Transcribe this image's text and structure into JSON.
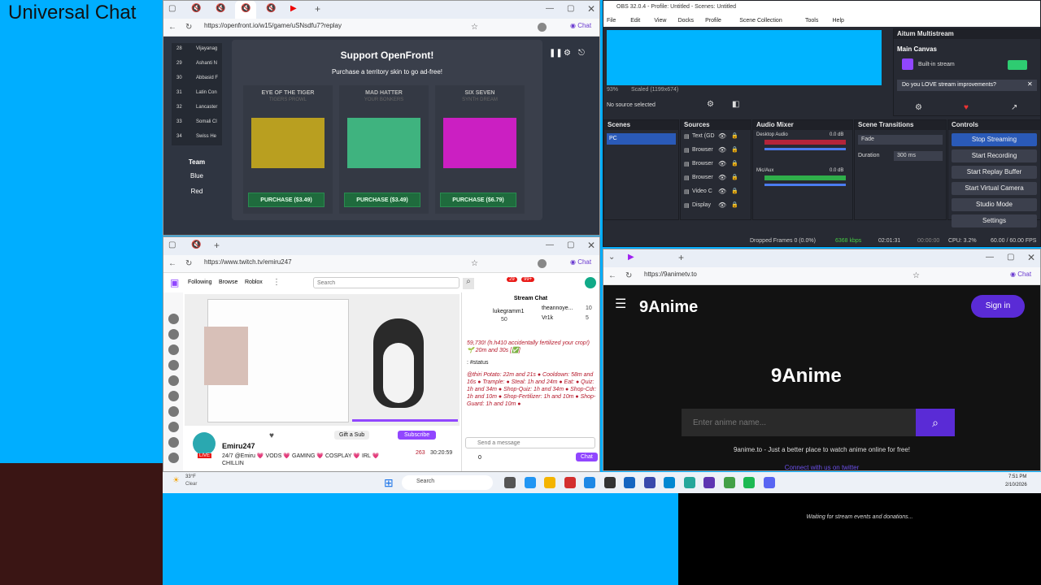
{
  "overlay": {
    "title": "Universal Chat",
    "waiting_text": "Waiting for stream events and donations..."
  },
  "openfront": {
    "url": "https://openfront.io/w15/game/uSNsdfu7?replay",
    "rank_rows": [
      {
        "rank": "28",
        "name": "Vijayanag"
      },
      {
        "rank": "29",
        "name": "Ashanti N"
      },
      {
        "rank": "30",
        "name": "Abbasid F"
      },
      {
        "rank": "31",
        "name": "Latin Con"
      },
      {
        "rank": "32",
        "name": "Lancaster"
      },
      {
        "rank": "33",
        "name": "Somali Cl"
      },
      {
        "rank": "34",
        "name": "Swiss He"
      }
    ],
    "team_header": "Team",
    "teams": [
      "Blue",
      "Red"
    ],
    "modal_title": "Support OpenFront!",
    "modal_subtitle": "Purchase a territory skin to go ad-free!",
    "skins": [
      {
        "name": "EYE OF THE TIGER",
        "sub": "TIGERS PROWL",
        "button": "PURCHASE  ($3.49)",
        "color": "#d1b21a"
      },
      {
        "name": "MAD HATTER",
        "sub": "YOUR BONKERS",
        "button": "PURCHASE  ($3.49)",
        "color": "#42c98a"
      },
      {
        "name": "SIX SEVEN",
        "sub": "SYNTH DREAM",
        "button": "PURCHASE  ($6.79)",
        "color": "#e61bd8"
      }
    ]
  },
  "obs": {
    "title": "OBS 32.0.4 - Profile: Untitled - Scenes: Untitled",
    "menu": [
      "File",
      "Edit",
      "View",
      "Docks",
      "Profile",
      "Scene Collection",
      "Tools",
      "Help"
    ],
    "zoom": "93%",
    "scaled": "Scaled (1199x674)",
    "no_source": "No source selected",
    "aitum_title": "Aitum Multistream",
    "main_canvas": "Main Canvas",
    "builtin_stream": "Built-in stream",
    "love_prompt": "Do you LOVE stream improvements?",
    "panels": {
      "scenes": "Scenes",
      "sources": "Sources",
      "mixer": "Audio Mixer",
      "transitions": "Scene Transitions",
      "controls": "Controls"
    },
    "scenes": [
      "PC"
    ],
    "sources": [
      "Text (GD",
      "Browser",
      "Browser",
      "Browser",
      "Video C",
      "Display"
    ],
    "mixer": [
      {
        "name": "Desktop Audio",
        "db": "0.0 dB"
      },
      {
        "name": "Mic/Aux",
        "db": "0.0 dB"
      }
    ],
    "transition": "Fade",
    "duration_label": "Duration",
    "duration_value": "300 ms",
    "controls": [
      "Stop Streaming",
      "Start Recording",
      "Start Replay Buffer",
      "Start Virtual Camera",
      "Studio Mode",
      "Settings"
    ],
    "status": {
      "dropped": "Dropped Frames 0 (0.0%)",
      "kbps": "6368 kbps",
      "live_time": "02:01:31",
      "rec_time": "00:00:00",
      "cpu": "CPU: 3.2%",
      "fps": "60.00 / 60.00 FPS"
    }
  },
  "twitch": {
    "url": "https://www.twitch.tv/emiru247",
    "nav": [
      "Following",
      "Browse",
      "Roblox"
    ],
    "search_placeholder": "Search",
    "badge_a": "29",
    "badge_b": "99+",
    "chat_title": "Stream Chat",
    "top_gifters": [
      {
        "name": "lukegramm1",
        "count": "50"
      },
      {
        "name": "theannoye...",
        "count": "10"
      },
      {
        "name": "Vr1k",
        "count": "5"
      }
    ],
    "chat_messages": [
      "59,730! (h.h410 accidentally fertilized your crop!) 🌱 20m and 30s [✅]",
      ": #status",
      "@thiri Potato: 22m and 21s ● Cooldown: 58m and 16s ● Trample: ● Steal: 1h and 24m ● Eat: ● Quiz: 1h and 34m ● Shop-Quiz: 1h and 34m ● Shop-Cdr: 1h and 10m ● Shop-Fertilizer: 1h and 10m ● Shop-Guard: 1h and 10m ●"
    ],
    "send_placeholder": "Send a message",
    "points": "0",
    "chat_button": "Chat",
    "gift_label": "Gift a Sub",
    "subscribe_label": "Subscribe",
    "streamer": "Emiru247",
    "stream_title": "24/7 @Emiru 💗 VODS 💗 GAMING 💗 COSPLAY 💗 IRL 💗",
    "stream_title2": "CHILLIN",
    "viewers": "263",
    "uptime": "30:20:59",
    "live_badge": "LIVE"
  },
  "anime": {
    "url": "https://9animetv.to",
    "logo": "9Anime",
    "sign_in": "Sign in",
    "search_placeholder": "Enter anime name...",
    "tagline": "9anime.to - Just a better place to watch anime online for free!",
    "twitter_link": "Connect with us on twitter"
  },
  "taskbar": {
    "search": "Search",
    "weather_temp": "33°F",
    "weather_desc": "Clear",
    "time": "7:51 PM",
    "date": "2/10/2026"
  }
}
